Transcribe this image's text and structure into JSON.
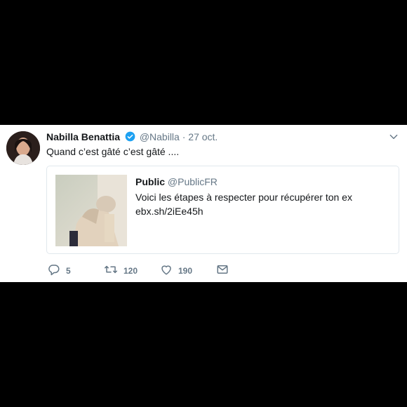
{
  "tweet": {
    "author_name": "Nabilla Benattia",
    "handle": "@Nabilla",
    "separator": "·",
    "date": "27 oct.",
    "text": "Quand c’est gâté c’est gâté ....",
    "icons": {
      "verified": "verified-badge-icon",
      "menu": "chevron-down-icon"
    },
    "quote": {
      "name": "Public",
      "handle": "@PublicFR",
      "text_line1": "Voici les étapes à respecter pour récupérer ton ex",
      "text_line2": "ebx.sh/2iEe45h"
    },
    "actions": {
      "replies": "5",
      "retweets": "120",
      "likes": "190"
    }
  },
  "colors": {
    "background": "#000000",
    "card_bg": "#ffffff",
    "verified": "#1da1f2",
    "secondary_text": "#657786",
    "primary_text": "#14171a"
  }
}
